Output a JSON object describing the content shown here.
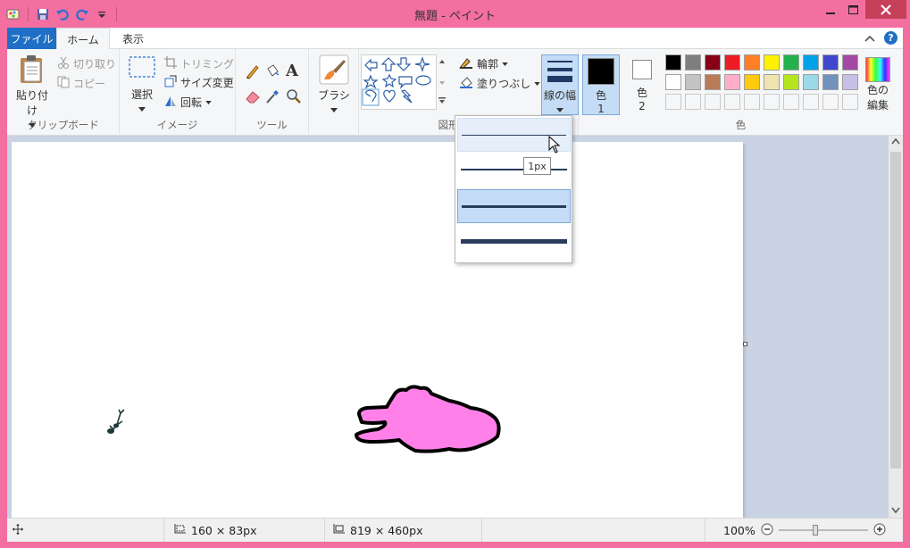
{
  "app": {
    "title": "無題 - ペイント",
    "accent": "#f26fa0"
  },
  "tabs": {
    "file": "ファイル",
    "home": "ホーム",
    "view": "表示"
  },
  "clipboard": {
    "paste": "貼り付け",
    "cut": "切り取り",
    "copy": "コピー",
    "label": "クリップボード"
  },
  "image": {
    "select": "選択",
    "crop": "トリミング",
    "resize": "サイズ変更",
    "rotate": "回転",
    "label": "イメージ"
  },
  "tools": {
    "label": "ツール"
  },
  "brushes": {
    "label": "ブラシ"
  },
  "shapes": {
    "outline": "輪郭",
    "fill": "塗りつぶし",
    "label": "図形"
  },
  "size": {
    "label": "線の幅",
    "tooltip": "1px"
  },
  "colors": {
    "color1": "色",
    "color1_num": "1",
    "color2": "色",
    "color2_num": "2",
    "edit": "色の",
    "edit2": "編集",
    "label": "色",
    "row1": [
      "#000000",
      "#7f7f7f",
      "#880015",
      "#ed1c24",
      "#ff7f27",
      "#fff200",
      "#22b14c",
      "#00a2e8",
      "#3f48cc",
      "#a349a4"
    ],
    "row2": [
      "#ffffff",
      "#c3c3c3",
      "#b97a57",
      "#ffaec9",
      "#ffc90e",
      "#efe4b0",
      "#b5e61d",
      "#99d9ea",
      "#7092be",
      "#c8bfe7"
    ]
  },
  "status": {
    "selection_size": "160 × 83px",
    "image_size": "819 × 460px",
    "zoom": "100%"
  }
}
